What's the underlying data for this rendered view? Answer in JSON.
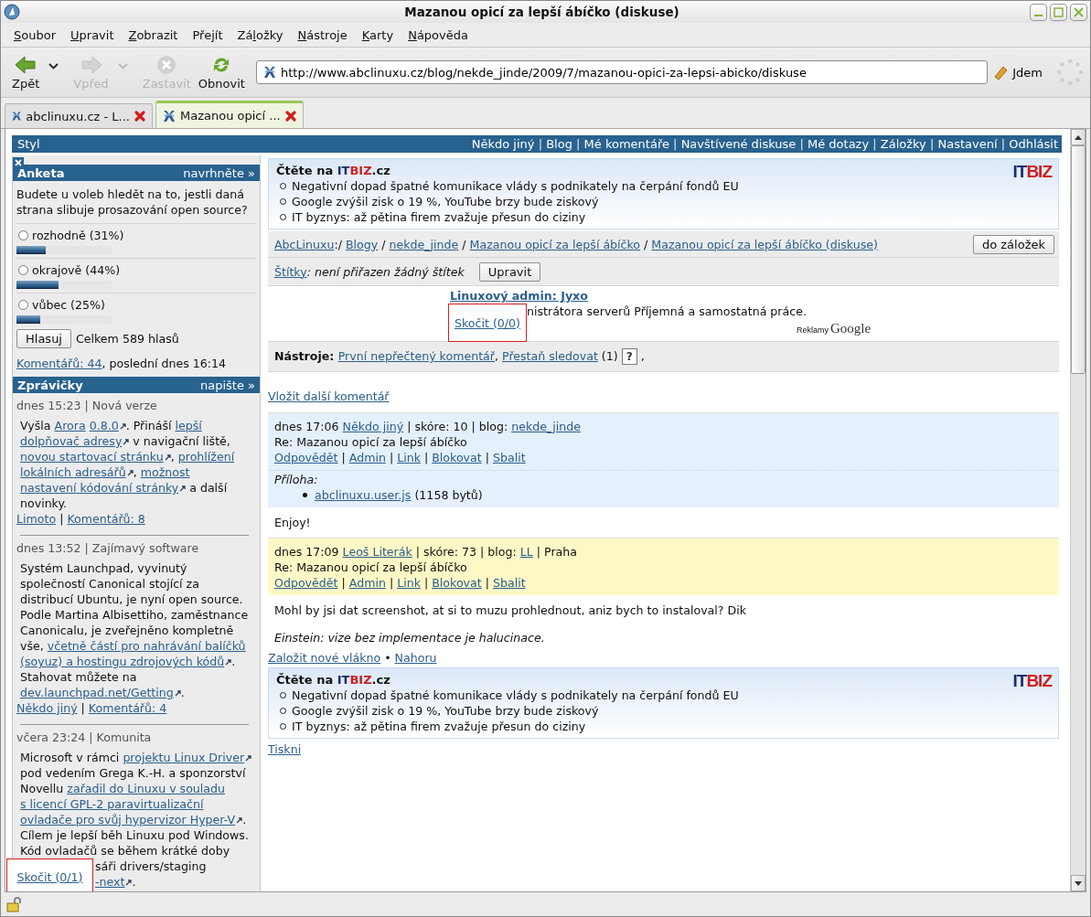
{
  "window": {
    "title": "Mazanou opicí za lepší ábíčko (diskuse)"
  },
  "menu": [
    {
      "key": "S",
      "after": "oubor"
    },
    {
      "key": "U",
      "after": "pravit"
    },
    {
      "key": "Z",
      "after": "obrazit"
    },
    {
      "before": "Pře",
      "key": "j",
      "after": "ít"
    },
    {
      "before": "Zá",
      "key": "l",
      "after": "ožky"
    },
    {
      "key": "N",
      "after": "ástroje"
    },
    {
      "key": "K",
      "after": "arty"
    },
    {
      "key": "N",
      "after": "ápověda"
    }
  ],
  "toolbar": [
    {
      "kind": "back",
      "label": "Zpět",
      "disabled": false,
      "has_menu": true
    },
    {
      "kind": "forward",
      "label": "Vpřed",
      "disabled": true,
      "has_menu": true
    },
    {
      "kind": "stop",
      "label": "Zastavit",
      "disabled": true,
      "has_menu": false
    },
    {
      "kind": "reload",
      "label": "Obnovit",
      "disabled": false,
      "has_menu": false
    }
  ],
  "address": {
    "value": "http://www.abclinuxu.cz/blog/nekde_jinde/2009/7/mazanou-opici-za-lepsi-abicko/diskuse",
    "go_label": "Jdem"
  },
  "tabs": [
    {
      "label": "abclinuxu.cz - L...",
      "selected": false
    },
    {
      "label": "Mazanou opicí ...",
      "selected": true
    }
  ],
  "page": {
    "top_bar": {
      "left": "Styl",
      "links": [
        {
          "kind": "link",
          "text": "Někdo jiný"
        },
        {
          "kind": "text",
          "text": " | "
        },
        {
          "kind": "link",
          "text": "Blog"
        },
        {
          "kind": "text",
          "text": " | "
        },
        {
          "kind": "link",
          "text": "Mé komentáře"
        },
        {
          "kind": "text",
          "text": " | "
        },
        {
          "kind": "link",
          "text": "Navštívené diskuse"
        },
        {
          "kind": "text",
          "text": " | "
        },
        {
          "kind": "link",
          "text": "Mé dotazy"
        },
        {
          "kind": "text",
          "text": " | "
        },
        {
          "kind": "link",
          "text": "Záložky"
        },
        {
          "kind": "text",
          "text": " | "
        },
        {
          "kind": "link",
          "text": "Nastavení"
        },
        {
          "kind": "text",
          "text": " | "
        },
        {
          "kind": "link",
          "text": "Odhlásit"
        }
      ]
    },
    "poll": {
      "title": "Anketa",
      "action": "navrhněte »",
      "question": "Budete u voleb hledět na to, jestli daná strana slibuje prosazování open source?",
      "options": [
        {
          "label": "rozhodně (31%)",
          "selected": false,
          "level": 0.31
        },
        {
          "label": "okrajově (44%)",
          "selected": false,
          "level": 0.44
        },
        {
          "label": "vůbec (25%)",
          "selected": false,
          "level": 0.25
        }
      ],
      "vote_button": "Hlasuj",
      "total": "Celkem 589 hlasů",
      "footer": [
        {
          "kind": "link",
          "text": "Komentářů: 44"
        },
        {
          "kind": "text",
          "text": ", poslední dnes 16:14"
        }
      ]
    },
    "news": {
      "title": "Zprávičky",
      "action": "napište »",
      "items": [
        {
          "meta": "dnes 15:23 | Nová verze",
          "text": [
            {
              "kind": "text",
              "text": "Vyšla "
            },
            {
              "kind": "link",
              "text": "Arora",
              "space": true
            },
            {
              "kind": "extlink",
              "text": "0.8.0"
            },
            {
              "kind": "text",
              "text": ". Přináší "
            },
            {
              "kind": "link",
              "text": "lepší",
              "space": true
            },
            {
              "kind": "extlink",
              "text": "dolpňovač adresy"
            },
            {
              "kind": "text",
              "text": " v navigační liště, "
            },
            {
              "kind": "extlink",
              "text": "novou startovací stránku"
            },
            {
              "kind": "text",
              "text": ", "
            },
            {
              "kind": "link",
              "text": "prohlížení",
              "space": true
            },
            {
              "kind": "extlink",
              "text": "lokálních adresářů"
            },
            {
              "kind": "text",
              "text": ", "
            },
            {
              "kind": "link",
              "text": "možnost",
              "space": true
            },
            {
              "kind": "extlink",
              "text": "nastavení kódování stránky"
            },
            {
              "kind": "text",
              "text": " a další novinky."
            }
          ],
          "footer": [
            {
              "kind": "link",
              "text": "Limoto"
            },
            {
              "kind": "text",
              "text": " | "
            },
            {
              "kind": "link",
              "text": "Komentářů: 8"
            }
          ]
        },
        {
          "meta": "dnes 13:52 | Zajímavý software",
          "text": [
            {
              "kind": "text",
              "text": "Systém Launchpad, vyvinutý společností Canonical stojící za distribucí Ubuntu, je nyní open source. Podle Martina Albisettiho, zaměstnance Canonicalu, je zveřejněno kompletně vše, "
            },
            {
              "kind": "link",
              "text": "včetně částí pro nahrávání balíčků",
              "space": true
            },
            {
              "kind": "extlink",
              "text": "(soyuz) a hostingu zdrojových kódů"
            },
            {
              "kind": "text",
              "text": ". Stahovat můžete na "
            },
            {
              "kind": "extlink",
              "text": "dev.launchpad.net/Getting"
            },
            {
              "kind": "text",
              "text": "."
            }
          ],
          "footer": [
            {
              "kind": "link",
              "text": "Někdo jiný"
            },
            {
              "kind": "text",
              "text": " | "
            },
            {
              "kind": "link",
              "text": "Komentářů: 4"
            }
          ]
        },
        {
          "meta": "včera 23:24 | Komunita",
          "text": [
            {
              "kind": "text",
              "text": "Microsoft v rámci "
            },
            {
              "kind": "extlink",
              "text": "projektu Linux Driver"
            },
            {
              "kind": "text",
              "text": " pod vedením Grega K.-H. a sponzorství Novellu "
            },
            {
              "kind": "link",
              "text": "zařadil do Linuxu v souladu",
              "space": true
            },
            {
              "kind": "link",
              "text": "s licencí GPL-2 paravirtualizační",
              "space": true
            },
            {
              "kind": "extlink",
              "text": "ovladače pro svůj hypervizor Hyper-V"
            },
            {
              "kind": "text",
              "text": ". Cílem je lepší běh Linuxu pod Windows. Kód ovladačů se během krátké doby"
            }
          ],
          "tail": [
            [
              {
                "kind": "text",
                "text": "sáři drivers/staging"
              }
            ],
            [
              {
                "kind": "extlink",
                "text": "-next"
              },
              {
                "kind": "text",
                "text": "."
              }
            ]
          ]
        }
      ]
    },
    "sidebar_jump": "Skočit (0/1)",
    "promo_top": {
      "prefix": "Čtěte na ",
      "brand_a": "IT",
      "brand_b": "BIZ",
      "suffix": ".cz",
      "headlines": [
        "Negativní dopad špatné komunikace vlády s podnikately na čerpání fondů EU",
        "Google zvýšil zisk o 19 %, YouTube brzy bude ziskový",
        "IT byznys: až pětina firem zvažuje přesun do ciziny"
      ],
      "logo_a": "IT",
      "logo_b": "BIZ"
    },
    "breadcrumb": [
      {
        "kind": "link",
        "text": "AbcLinuxu"
      },
      {
        "kind": "text",
        "text": ":/ "
      },
      {
        "kind": "link",
        "text": "Blogy"
      },
      {
        "kind": "text",
        "text": " / "
      },
      {
        "kind": "link",
        "text": "nekde_jinde"
      },
      {
        "kind": "text",
        "text": " / "
      },
      {
        "kind": "link",
        "text": "Mazanou opicí za lepší ábíčko"
      },
      {
        "kind": "text",
        "text": " / "
      },
      {
        "kind": "link",
        "text": "Mazanou opicí za lepší ábíčko (diskuse)"
      }
    ],
    "bookmark_button": "do záložek",
    "tags": [
      {
        "kind": "link",
        "text": "Štítky"
      },
      {
        "kind": "italic",
        "text": ": není přiřazen žádný štítek"
      }
    ],
    "tags_button": "Upravit",
    "ad": {
      "title": "Linuxový admin: Jyxo",
      "text": "nistrátora serverů Příjemná a samostatná práce.",
      "jump": "Skočit (0/0)",
      "by": "Reklamy",
      "brand": "Google"
    },
    "tools": [
      {
        "kind": "bold",
        "text": "Nástroje: "
      },
      {
        "kind": "link",
        "text": "První nepřečtený komentář"
      },
      {
        "kind": "text",
        "text": ", "
      },
      {
        "kind": "link",
        "text": "Přestaň sledovat"
      },
      {
        "kind": "text",
        "text": " (1) "
      },
      {
        "kind": "boxbutton",
        "text": "?"
      },
      {
        "kind": "text",
        "text": " ,"
      }
    ],
    "add_comment": "Vložit další komentář",
    "comments": [
      {
        "new": false,
        "meta": [
          {
            "kind": "text",
            "text": "dnes 17:06 "
          },
          {
            "kind": "link",
            "text": "Někdo jiný"
          },
          {
            "kind": "text",
            "text": " | skóre: 10 | blog: "
          },
          {
            "kind": "link",
            "text": "nekde_jinde"
          }
        ],
        "title": "Re: Mazanou opicí za lepší ábíčko",
        "actions": [
          {
            "kind": "link",
            "text": "Odpovědět"
          },
          {
            "kind": "text",
            "text": " | "
          },
          {
            "kind": "link",
            "text": "Admin"
          },
          {
            "kind": "text",
            "text": " | "
          },
          {
            "kind": "link",
            "text": "Link"
          },
          {
            "kind": "text",
            "text": " | "
          },
          {
            "kind": "link",
            "text": "Blokovat"
          },
          {
            "kind": "text",
            "text": " | "
          },
          {
            "kind": "link",
            "text": "Sbalit"
          }
        ],
        "attachment": {
          "label": "Příloha:",
          "file": "abclinuxu.user.js",
          "size": "(1158 bytů)"
        },
        "body": "Enjoy!"
      },
      {
        "new": true,
        "meta": [
          {
            "kind": "text",
            "text": "dnes 17:09 "
          },
          {
            "kind": "link",
            "text": "Leoš Literák"
          },
          {
            "kind": "text",
            "text": " | skóre: 73 | blog: "
          },
          {
            "kind": "link",
            "text": "LL"
          },
          {
            "kind": "text",
            "text": " | Praha"
          }
        ],
        "title": "Re: Mazanou opicí za lepší ábíčko",
        "actions": [
          {
            "kind": "link",
            "text": "Odpovědět"
          },
          {
            "kind": "text",
            "text": " | "
          },
          {
            "kind": "link",
            "text": "Admin"
          },
          {
            "kind": "text",
            "text": " | "
          },
          {
            "kind": "link",
            "text": "Link"
          },
          {
            "kind": "text",
            "text": " | "
          },
          {
            "kind": "link",
            "text": "Blokovat"
          },
          {
            "kind": "text",
            "text": " | "
          },
          {
            "kind": "link",
            "text": "Sbalit"
          }
        ],
        "body": "Mohl by jsi dat screenshot, at si to muzu prohlednout, aniz bych to instaloval? Dik",
        "signature": "Einstein: vize bez implementace je halucinace."
      }
    ],
    "thread_links": [
      {
        "kind": "link",
        "text": "Založit nové vlákno"
      },
      {
        "kind": "text",
        "text": " • "
      },
      {
        "kind": "link",
        "text": "Nahoru"
      }
    ],
    "promo_bottom": {
      "prefix": "Čtěte na ",
      "brand_a": "IT",
      "brand_b": "BIZ",
      "suffix": ".cz",
      "headlines": [
        "Negativní dopad špatné komunikace vlády s podnikately na čerpání fondů EU",
        "Google zvýšil zisk o 19 %, YouTube brzy bude ziskový",
        "IT byznys: až pětina firem zvažuje přesun do ciziny"
      ],
      "logo_a": "IT",
      "logo_b": "BIZ"
    },
    "print": "Tiskni"
  }
}
